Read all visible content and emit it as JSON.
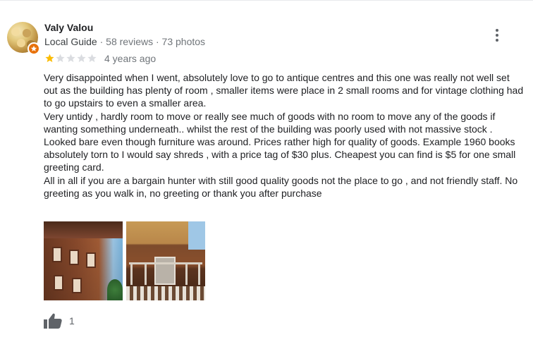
{
  "review": {
    "author": "Valy Valou",
    "guide_label": "Local Guide",
    "reviews_count": "58 reviews",
    "photos_count": "73 photos",
    "meta_separator": "·",
    "rating": 1,
    "rating_max": 5,
    "time_ago": "4 years ago",
    "paragraphs": [
      "Very disappointed when I went,  absolutely love to go to antique centres and this one was really not well set out as the building has plenty of room , smaller items were place in 2 small rooms and for vintage clothing had to go upstairs to even a smaller area.",
      "Very untidy , hardly room to move or really see much of goods with no room to move any of the goods if wanting something underneath.. whilst the rest of the building was poorly used with not massive stock . Looked bare even though furniture was around. Prices rather high for quality of goods. Example 1960 books absolutely torn to I would say shreds , with a price tag of $30 plus. Cheapest you can find is $5 for one small greeting card.",
      "All in all if you are a bargain hunter with still good quality goods not the place to go , and not friendly staff. No greeting as you walk in, no greeting or thank you after purchase"
    ],
    "like_count": "1"
  },
  "icons": {
    "avatar": "profile-photo",
    "badge": "local-guide-star-icon",
    "menu": "more-vert-icon",
    "like": "thumb-up-icon",
    "star_filled": "star-filled-icon",
    "star_empty": "star-empty-icon"
  },
  "colors": {
    "star_filled": "#fbbc04",
    "star_empty": "#dadce0",
    "badge": "#e8710a",
    "secondary_text": "#70757a"
  }
}
